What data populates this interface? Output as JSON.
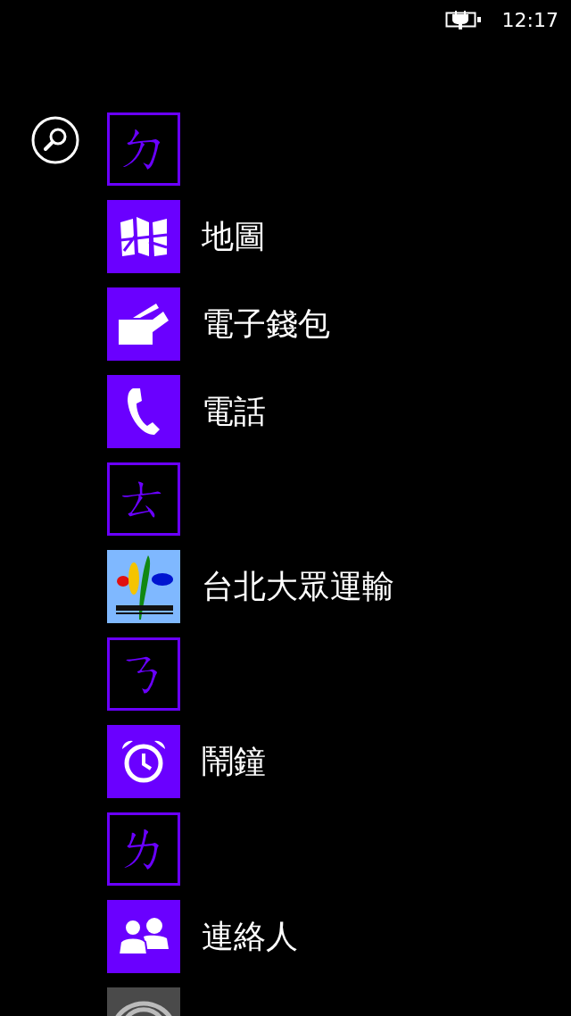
{
  "status_bar": {
    "time": "12:17"
  },
  "items": [
    {
      "kind": "letter",
      "label": "ㄉ"
    },
    {
      "kind": "map",
      "label": "地圖"
    },
    {
      "kind": "wallet",
      "label": "電子錢包"
    },
    {
      "kind": "phone",
      "label": "電話"
    },
    {
      "kind": "letter",
      "label": "ㄊ"
    },
    {
      "kind": "transit",
      "label": "台北大眾運輸"
    },
    {
      "kind": "letter",
      "label": "ㄋ"
    },
    {
      "kind": "alarm",
      "label": "鬧鐘"
    },
    {
      "kind": "letter",
      "label": "ㄌ"
    },
    {
      "kind": "people",
      "label": "連絡人"
    },
    {
      "kind": "arcs"
    }
  ]
}
